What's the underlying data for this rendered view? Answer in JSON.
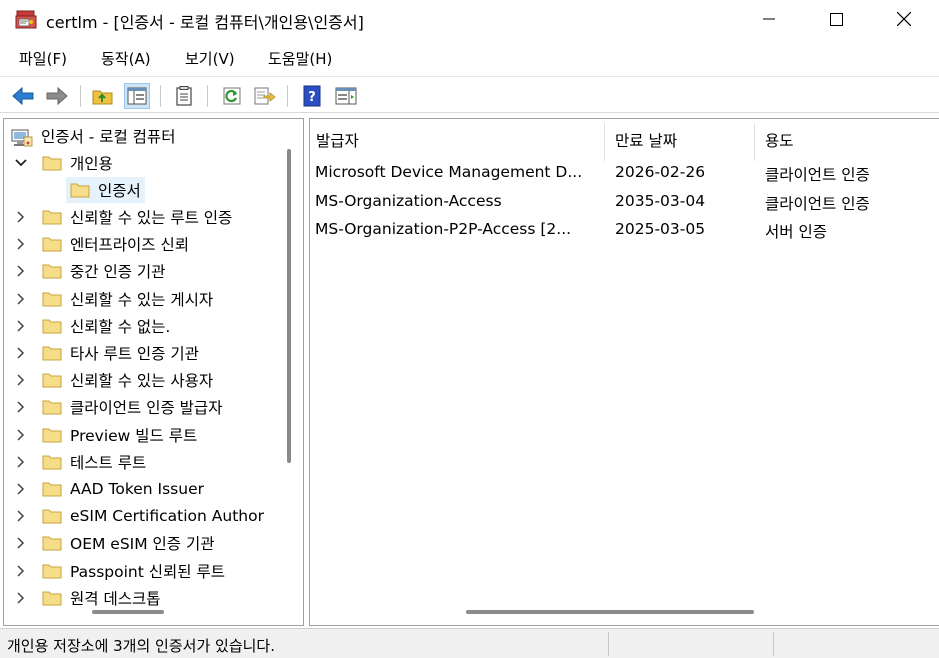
{
  "window": {
    "title": "certlm - [인증서 - 로컬 컴퓨터\\개인용\\인증서]"
  },
  "menu": {
    "items": [
      "파일(F)",
      "동작(A)",
      "보기(V)",
      "도움말(H)"
    ]
  },
  "toolbar": {
    "buttons": [
      "back-icon",
      "forward-icon",
      "up-folder-icon",
      "show-hide-tree-icon",
      "properties-icon",
      "refresh-icon",
      "export-list-icon",
      "help-icon",
      "action-pane-icon"
    ]
  },
  "tree": {
    "root": "인증서 - 로컬 컴퓨터",
    "personal": "개인용",
    "certificates": "인증서",
    "stores": [
      "신뢰할 수 있는 루트 인증",
      "엔터프라이즈 신뢰",
      "중간 인증 기관",
      "신뢰할 수 있는 게시자",
      "신뢰할 수 없는.",
      "타사 루트 인증 기관",
      "신뢰할 수 있는 사용자",
      "클라이언트 인증 발급자",
      "Preview 빌드 루트",
      "테스트 루트",
      "AAD Token Issuer",
      "eSIM Certification Author",
      "OEM eSIM 인증 기관",
      "Passpoint 신뢰된 루트",
      "원격 데스크톱"
    ]
  },
  "list": {
    "columns": [
      "발급자",
      "만료 날짜",
      "용도"
    ],
    "rows": [
      [
        "Microsoft Device Management D...",
        "2026-02-26",
        "클라이언트 인증"
      ],
      [
        "MS-Organization-Access",
        "2035-03-04",
        "클라이언트 인증"
      ],
      [
        "MS-Organization-P2P-Access [2...",
        "2025-03-05",
        "서버 인증"
      ]
    ]
  },
  "status": {
    "text": "개인용 저장소에 3개의 인증서가 있습니다."
  },
  "colors": {
    "folder": "#f0d264",
    "folder_edge": "#c9a53a",
    "selected": "#e5f1fb",
    "accent_blue": "#2a7fd4",
    "toolbar_pressed": "#cce4f7"
  }
}
